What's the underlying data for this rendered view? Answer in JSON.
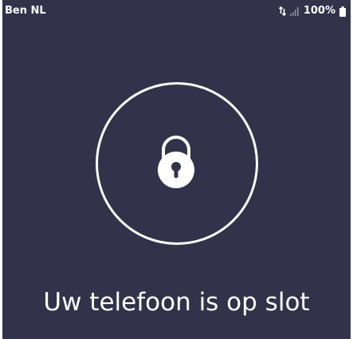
{
  "status_bar": {
    "carrier": "Ben NL",
    "battery_percent": "100%",
    "icons": [
      "network-activity-icon",
      "signal-icon",
      "battery-icon"
    ]
  },
  "lock_screen": {
    "icon": "padlock-icon",
    "message": "Uw telefoon is op slot"
  },
  "colors": {
    "background": "#32334a",
    "foreground": "#ffffff"
  }
}
